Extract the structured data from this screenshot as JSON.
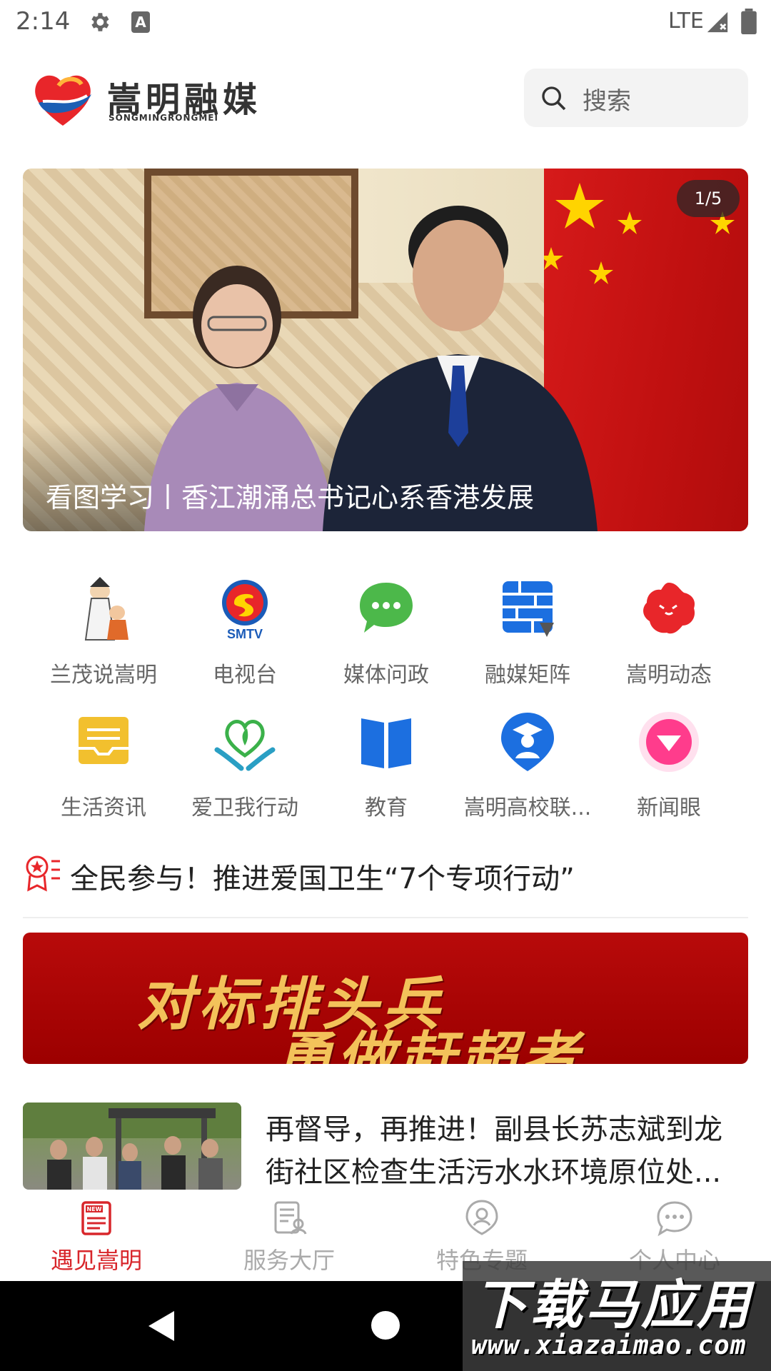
{
  "status_bar": {
    "time": "2:14",
    "network": "LTE",
    "icons": [
      "gear-icon",
      "a-icon",
      "signal-icon",
      "battery-icon"
    ]
  },
  "header": {
    "logo_text": "嵩明融媒",
    "logo_subtext": "SONGMINGRONGMEI",
    "search_placeholder": "搜索"
  },
  "banner": {
    "counter": "1/5",
    "caption": "看图学习丨香江潮涌总书记心系香港发展"
  },
  "grid": {
    "items": [
      {
        "label": "兰茂说嵩明",
        "icon": "lanmao-character-icon"
      },
      {
        "label": "电视台",
        "icon": "smtv-logo-icon",
        "icon_text": "SMTV"
      },
      {
        "label": "媒体问政",
        "icon": "chat-bubble-icon"
      },
      {
        "label": "融媒矩阵",
        "icon": "grid-matrix-icon"
      },
      {
        "label": "嵩明动态",
        "icon": "red-flower-icon"
      },
      {
        "label": "生活资讯",
        "icon": "inbox-icon"
      },
      {
        "label": "爱卫我行动",
        "icon": "heart-hands-icon"
      },
      {
        "label": "教育",
        "icon": "book-icon"
      },
      {
        "label": "嵩明高校联...",
        "icon": "graduate-icon"
      },
      {
        "label": "新闻眼",
        "icon": "news-eye-icon"
      }
    ]
  },
  "headline": {
    "text": "全民参与！推进爱国卫生“7个专项行动”"
  },
  "promo": {
    "line1": "对标排头兵",
    "line2": "勇做赶超者"
  },
  "news": [
    {
      "title": "再督导，再推进！副县长苏志斌到龙街社区检查生活污水水环境原位处..."
    }
  ],
  "bottom_nav": {
    "items": [
      {
        "label": "遇见嵩明",
        "icon": "news-icon",
        "active": true
      },
      {
        "label": "服务大厅",
        "icon": "service-icon",
        "active": false
      },
      {
        "label": "特色专题",
        "icon": "special-icon",
        "active": false
      },
      {
        "label": "个人中心",
        "icon": "profile-icon",
        "active": false
      }
    ]
  },
  "watermark": {
    "main": "下载马应用",
    "url": "www.xiazaimao.com"
  },
  "colors": {
    "accent": "#d8262b",
    "promo_bg": "#9c0000",
    "promo_text": "#f3c25a",
    "nav_inactive": "#aaaaaa"
  }
}
